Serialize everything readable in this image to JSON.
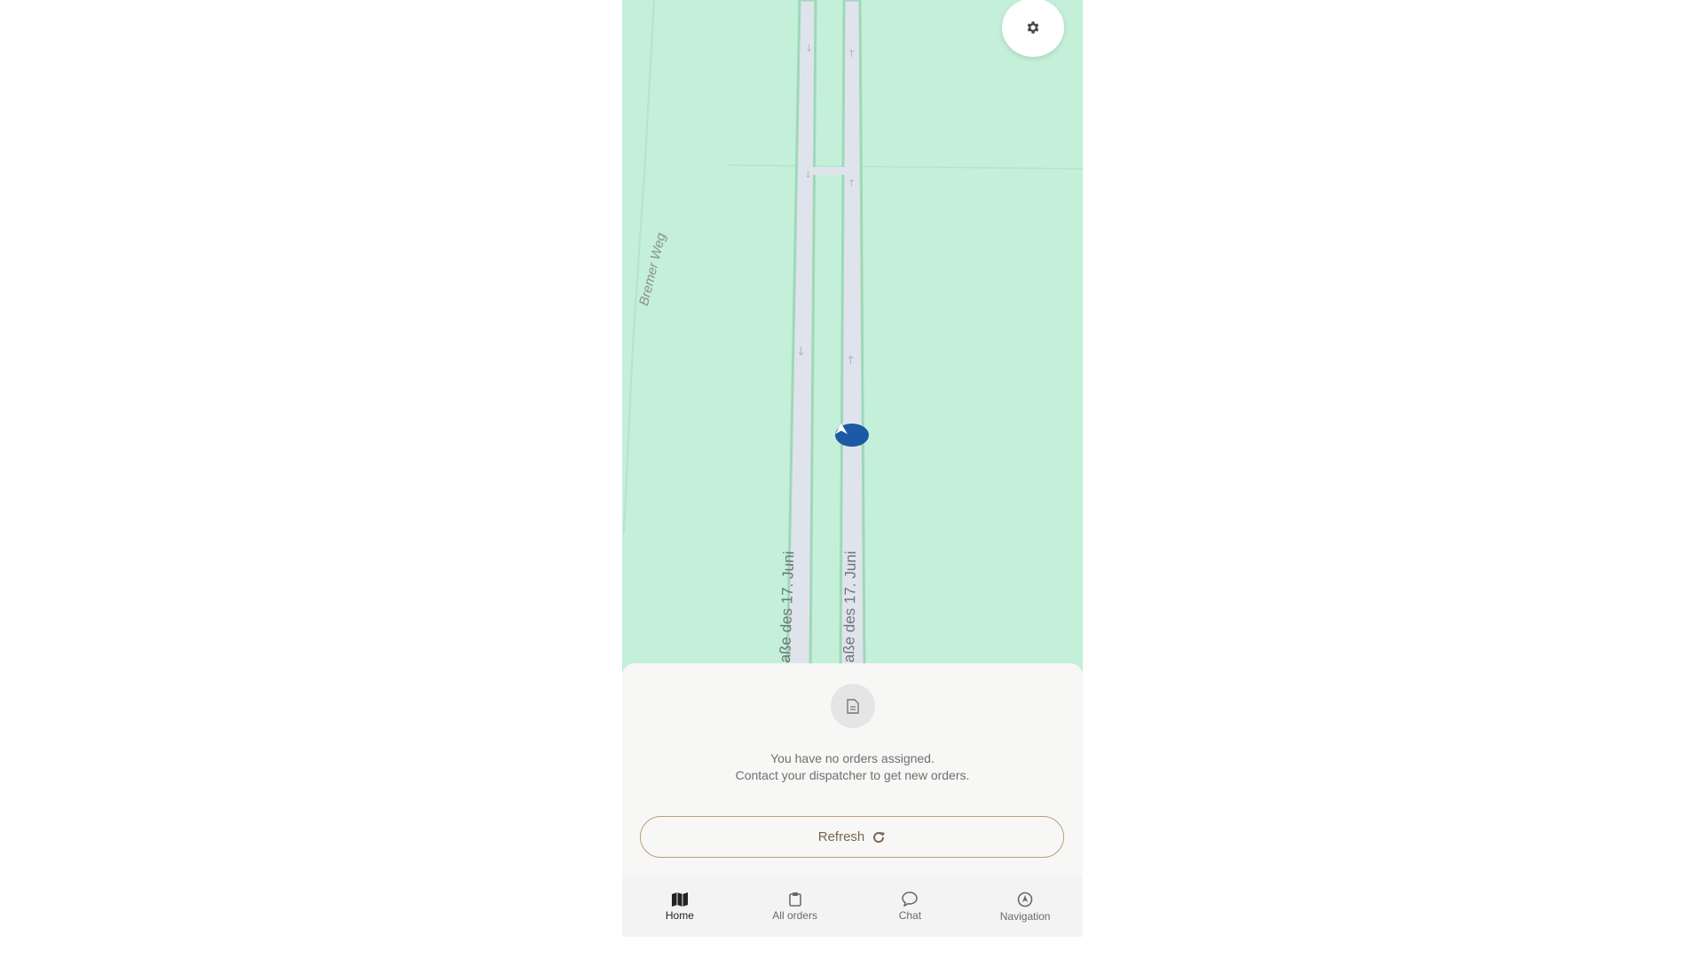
{
  "map": {
    "street_bremer": "Bremer Weg",
    "street_left": "aße des 17. Juni",
    "street_right": "aße des 17. Juni"
  },
  "icons": {
    "settings": "gear-icon",
    "location": "navigation-arrow-icon",
    "document": "document-icon",
    "refresh": "refresh-icon"
  },
  "orders": {
    "message_line1": "You have no orders assigned.",
    "message_line2": "Contact your dispatcher to get new orders.",
    "refresh_label": "Refresh"
  },
  "nav": {
    "items": [
      {
        "label": "Home",
        "icon": "map-icon",
        "active": true
      },
      {
        "label": "All orders",
        "icon": "clipboard-icon",
        "active": false
      },
      {
        "label": "Chat",
        "icon": "chat-bubble-icon",
        "active": false
      },
      {
        "label": "Navigation",
        "icon": "navigation-icon",
        "active": false
      }
    ]
  },
  "colors": {
    "map_green": "#c4efd9",
    "road": "#dfe4ec",
    "marker": "#1c5aa6",
    "refresh_border": "#b99f7c"
  }
}
